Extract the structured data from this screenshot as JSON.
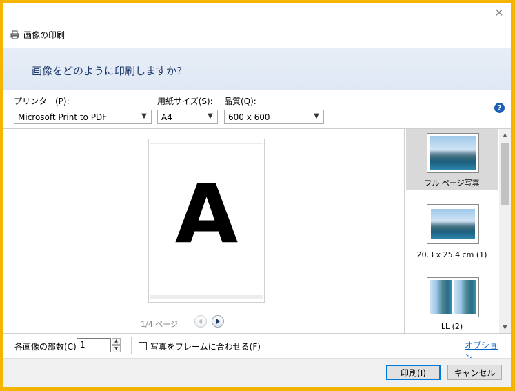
{
  "dialog": {
    "title": "画像の印刷",
    "heading": "画像をどのように印刷しますか?"
  },
  "printer": {
    "label": "プリンター(P):",
    "value": "Microsoft Print to PDF"
  },
  "paper": {
    "label": "用紙サイズ(S):",
    "value": "A4"
  },
  "quality": {
    "label": "品質(Q):",
    "value": "600 x 600"
  },
  "help_icon": "?",
  "preview": {
    "page_letter": "A",
    "pager": "1/4 ページ"
  },
  "layouts": [
    {
      "label": "フル ページ写真",
      "selected": true
    },
    {
      "label": "20.3 x 25.4 cm (1)",
      "selected": false
    },
    {
      "label": "LL (2)",
      "selected": false
    }
  ],
  "copies": {
    "label": "各画像の部数(C):",
    "value": "1"
  },
  "fit_frame": {
    "label": "写真をフレームに合わせる(F)",
    "checked": false
  },
  "options_link": "オプション...",
  "buttons": {
    "print": "印刷(I)",
    "cancel": "キャンセル"
  },
  "colors": {
    "accent": "#0078d7",
    "link": "#0066cc",
    "window_border": "#f4b400"
  }
}
